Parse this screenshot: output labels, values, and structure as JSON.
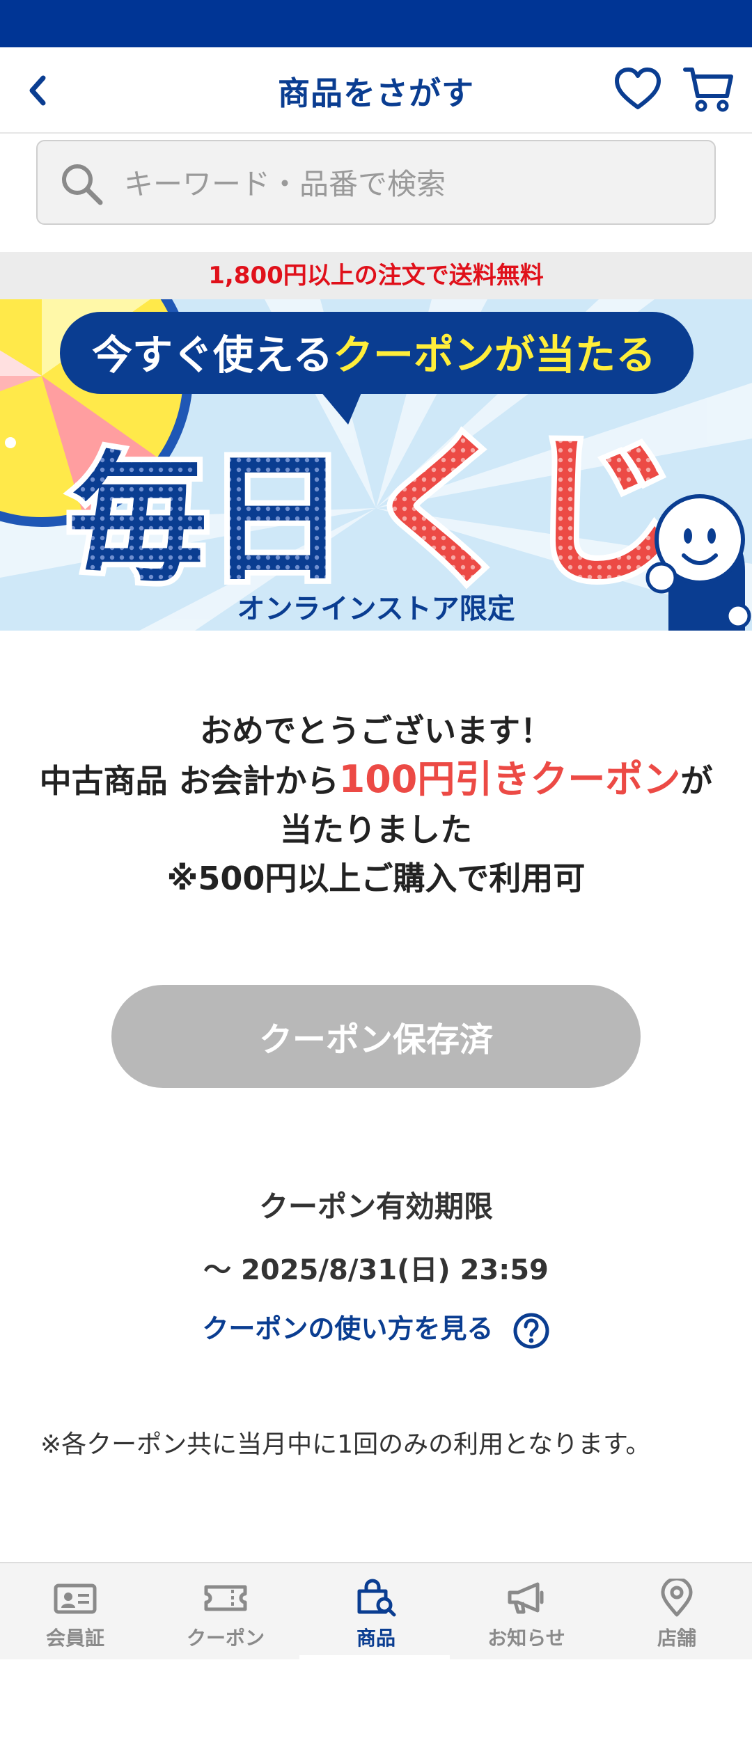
{
  "header": {
    "title": "商品をさがす"
  },
  "search": {
    "placeholder": "キーワード・品番で検索"
  },
  "promo_band": {
    "text": "1,800円以上の注文で送料無料"
  },
  "banner": {
    "headline_part1": "今すぐ使える",
    "headline_part2": "クーポンが当たる",
    "main_kanji": "毎日",
    "main_kana": "くじ",
    "footer": "オンラインストア限定"
  },
  "message": {
    "line1": "おめでとうございます！",
    "line2_prefix": "中古商品 お会計から",
    "line2_accent": "100円引きクーポン",
    "line2_suffix": "が",
    "line3": "当たりました",
    "line4": "※500円以上ご購入で利用可"
  },
  "coupon_button": {
    "label": "クーポン保存済"
  },
  "expiry": {
    "title": "クーポン有効期限",
    "date": "〜 2025/8/31(日) 23:59"
  },
  "howto": {
    "label": "クーポンの使い方を見る"
  },
  "note": {
    "text": "※各クーポン共に当月中に1回のみの利用となります。"
  },
  "bottom_nav": {
    "items": [
      {
        "label": "会員証",
        "icon": "member-card-icon"
      },
      {
        "label": "クーポン",
        "icon": "ticket-icon"
      },
      {
        "label": "商品",
        "icon": "shopping-bag-search-icon",
        "active": true
      },
      {
        "label": "お知らせ",
        "icon": "megaphone-icon"
      },
      {
        "label": "店舗",
        "icon": "location-pin-icon"
      }
    ]
  },
  "colors": {
    "brand_blue": "#0a3d91",
    "status_bar": "#003595",
    "accent_red": "#ec4a45",
    "promo_red": "#e0101a",
    "disabled_button": "#b8b8b8"
  }
}
